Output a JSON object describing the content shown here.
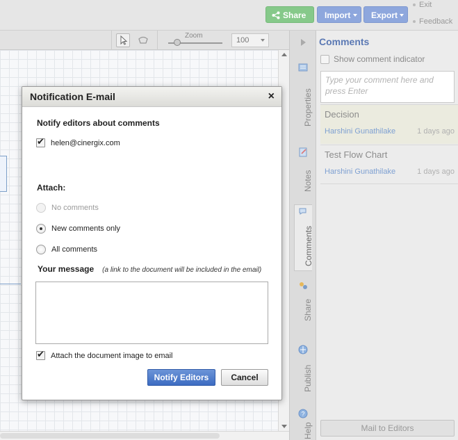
{
  "topbar": {
    "share_label": "Share",
    "import_label": "Import",
    "export_label": "Export",
    "exit_label": "Exit",
    "feedback_label": "Feedback"
  },
  "toolbar": {
    "zoom_label": "Zoom",
    "zoom_value": "100"
  },
  "side_tabs": [
    {
      "label": "Properties",
      "icon": "properties-icon"
    },
    {
      "label": "Notes",
      "icon": "notes-icon"
    },
    {
      "label": "Comments",
      "icon": "comments-icon"
    },
    {
      "label": "Share",
      "icon": "share-icon"
    },
    {
      "label": "Publish",
      "icon": "publish-icon"
    },
    {
      "label": "Help",
      "icon": "help-icon"
    }
  ],
  "panel": {
    "title": "Comments",
    "show_indicator_label": "Show comment indicator",
    "comment_placeholder": "Type your comment here and press Enter",
    "comments": [
      {
        "title": "Decision",
        "author": "Harshini Gunathilake",
        "time": "1 days ago"
      },
      {
        "title": "Test Flow Chart",
        "author": "Harshini Gunathilake",
        "time": "1 days ago"
      }
    ],
    "mail_button": "Mail to Editors"
  },
  "dialog": {
    "title": "Notification E-mail",
    "close_glyph": "×",
    "notify_heading": "Notify editors about comments",
    "editor_email": "helen@cinergix.com",
    "attach_heading": "Attach:",
    "options": {
      "no_comments": "No comments",
      "new_comments_only": "New comments only",
      "all_comments": "All comments"
    },
    "selected_option": "new_comments_only",
    "message_heading": "Your message",
    "message_hint": "(a link to the document will be included in the email)",
    "message_value": "",
    "attach_image_label": "Attach the document image to email",
    "notify_button": "Notify Editors",
    "cancel_button": "Cancel"
  },
  "colors": {
    "share_green": "#86c98a",
    "button_blue": "#8ea7dd",
    "panel_title_blue": "#5b79b4",
    "author_blue": "#7ea0d2",
    "primary_button": "#3c6bc2"
  }
}
